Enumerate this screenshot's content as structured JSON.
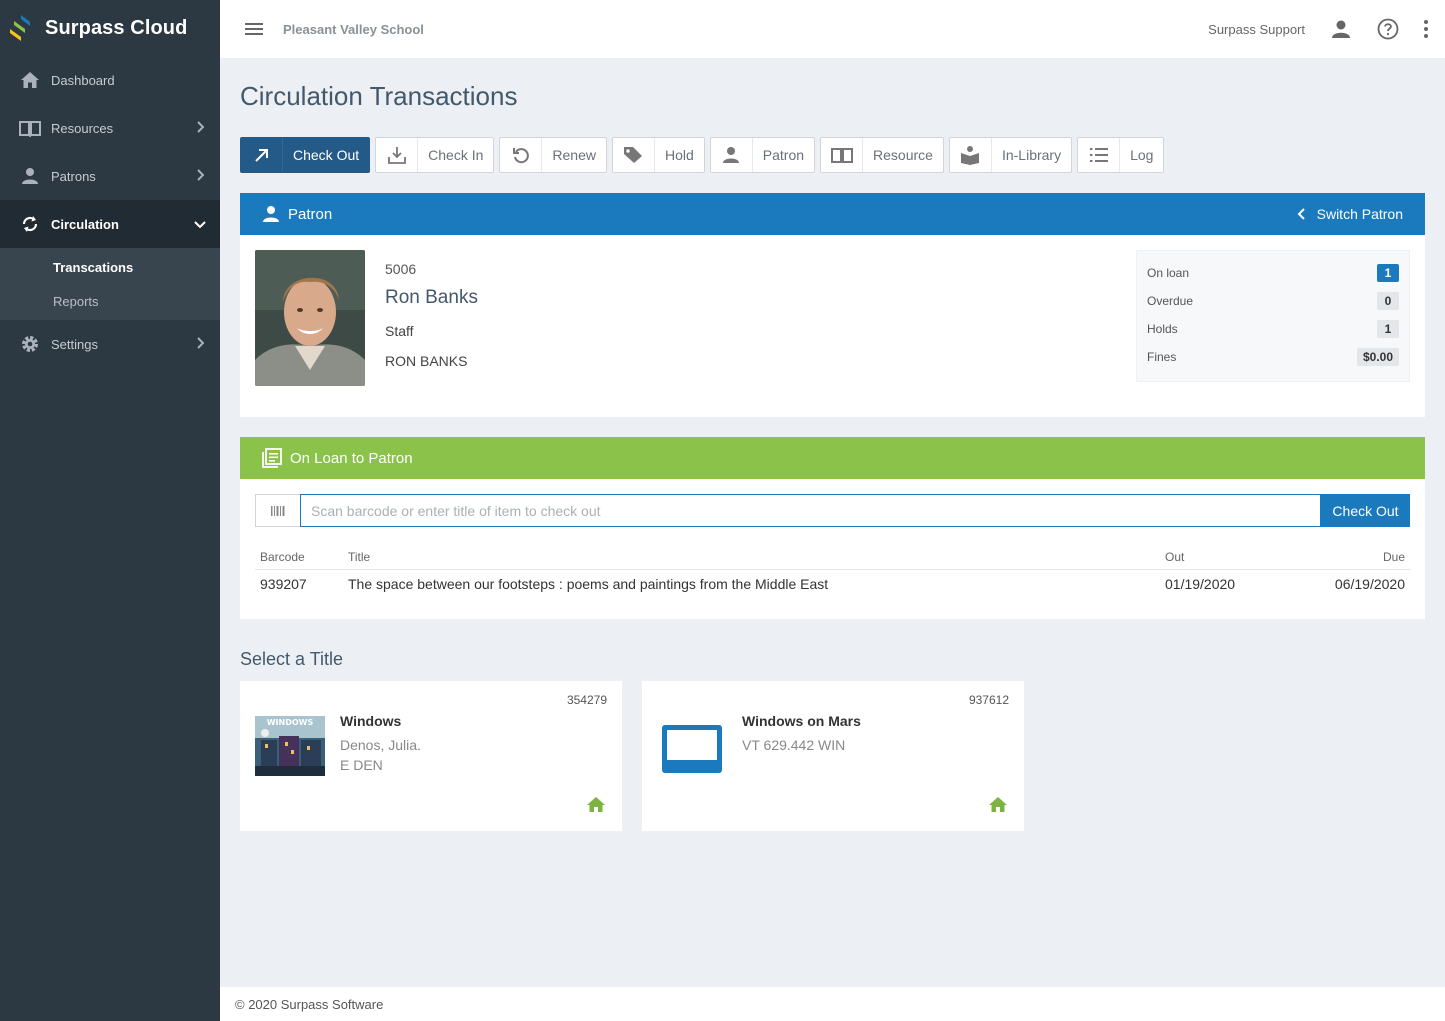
{
  "brand": {
    "name": "Surpass Cloud"
  },
  "sidebar": {
    "items": [
      {
        "label": "Dashboard",
        "icon": "home-icon"
      },
      {
        "label": "Resources",
        "icon": "book-icon"
      },
      {
        "label": "Patrons",
        "icon": "person-icon"
      },
      {
        "label": "Circulation",
        "icon": "refresh-icon"
      },
      {
        "label": "Settings",
        "icon": "gear-icon"
      }
    ],
    "sub_items": [
      {
        "label": "Transcations"
      },
      {
        "label": "Reports"
      }
    ]
  },
  "topbar": {
    "school": "Pleasant Valley School",
    "user": "Surpass Support"
  },
  "page": {
    "title": "Circulation Transactions"
  },
  "toolbar": {
    "buttons": [
      {
        "label": "Check Out",
        "icon": "arrow-up-right-icon"
      },
      {
        "label": "Check In",
        "icon": "download-icon"
      },
      {
        "label": "Renew",
        "icon": "undo-icon"
      },
      {
        "label": "Hold",
        "icon": "tag-icon"
      },
      {
        "label": "Patron",
        "icon": "person-icon"
      },
      {
        "label": "Resource",
        "icon": "book-icon"
      },
      {
        "label": "In-Library",
        "icon": "reader-icon"
      },
      {
        "label": "Log",
        "icon": "list-icon"
      }
    ]
  },
  "patron_panel": {
    "title": "Patron",
    "switch_label": "Switch Patron",
    "id": "5006",
    "name": "Ron Banks",
    "type": "Staff",
    "full_name": "RON BANKS",
    "stats": [
      {
        "label": "On loan",
        "value": "1"
      },
      {
        "label": "Overdue",
        "value": "0"
      },
      {
        "label": "Holds",
        "value": "1"
      },
      {
        "label": "Fines",
        "value": "$0.00"
      }
    ]
  },
  "loan_panel": {
    "title": "On Loan to Patron",
    "placeholder": "Scan barcode or enter title of item to check out",
    "button": "Check Out",
    "columns": {
      "barcode": "Barcode",
      "title": "Title",
      "out": "Out",
      "due": "Due"
    },
    "rows": [
      {
        "barcode": "939207",
        "title": "The space between our footsteps : poems and paintings from the Middle East",
        "out": "01/19/2020",
        "due": "06/19/2020"
      }
    ]
  },
  "select_title": {
    "heading": "Select a Title",
    "cards": [
      {
        "number": "354279",
        "title": "Windows",
        "author": "Denos, Julia.",
        "call": "E DEN",
        "cover_text": "WINDOWS"
      },
      {
        "number": "937612",
        "title": "Windows on Mars",
        "author": "VT 629.442 WIN",
        "call": ""
      }
    ]
  },
  "footer": {
    "text": "© 2020 Surpass Software"
  },
  "colors": {
    "primary": "#1b7abe",
    "dark_button": "#245a87",
    "green": "#8bc34a",
    "sidebar": "#2c3842"
  }
}
